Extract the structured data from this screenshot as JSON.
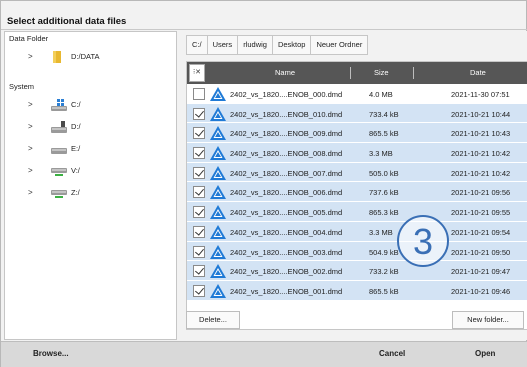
{
  "dialog": {
    "title": "Select additional data files"
  },
  "left_panel": {
    "data_folder_label": "Data Folder",
    "data_folders": [
      {
        "label": "D:/DATA",
        "icon": "folder-icon"
      }
    ],
    "system_label": "System",
    "drives": [
      {
        "label": "C:/",
        "icon": "system-drive-icon"
      },
      {
        "label": "D:/",
        "icon": "hard-drive-icon"
      },
      {
        "label": "E:/",
        "icon": "hard-drive-icon"
      },
      {
        "label": "V:/",
        "icon": "network-drive-icon"
      },
      {
        "label": "Z:/",
        "icon": "network-drive-icon"
      }
    ]
  },
  "breadcrumbs": [
    "C:/",
    "Users",
    "rludwig",
    "Desktop",
    "Neuer Ordner"
  ],
  "table": {
    "column_toggle": "⁝✕",
    "columns": {
      "name": "Name",
      "size": "Size",
      "date": "Date"
    },
    "rows": [
      {
        "name": "2402_vs_1820....ENOB_000.dmd",
        "size": "4.0 MB",
        "date": "2021-11-30 07:51",
        "checked": false
      },
      {
        "name": "2402_vs_1820....ENOB_010.dmd",
        "size": "733.4 kB",
        "date": "2021-10-21 10:44",
        "checked": true
      },
      {
        "name": "2402_vs_1820....ENOB_009.dmd",
        "size": "865.5 kB",
        "date": "2021-10-21 10:43",
        "checked": true
      },
      {
        "name": "2402_vs_1820....ENOB_008.dmd",
        "size": "3.3 MB",
        "date": "2021-10-21 10:42",
        "checked": true
      },
      {
        "name": "2402_vs_1820....ENOB_007.dmd",
        "size": "505.0 kB",
        "date": "2021-10-21 10:42",
        "checked": true
      },
      {
        "name": "2402_vs_1820....ENOB_006.dmd",
        "size": "737.6 kB",
        "date": "2021-10-21 09:56",
        "checked": true
      },
      {
        "name": "2402_vs_1820....ENOB_005.dmd",
        "size": "865.3 kB",
        "date": "2021-10-21 09:55",
        "checked": true
      },
      {
        "name": "2402_vs_1820....ENOB_004.dmd",
        "size": "3.3 MB",
        "date": "2021-10-21 09:54",
        "checked": true
      },
      {
        "name": "2402_vs_1820....ENOB_003.dmd",
        "size": "504.9 kB",
        "date": "2021-10-21 09:50",
        "checked": true
      },
      {
        "name": "2402_vs_1820....ENOB_002.dmd",
        "size": "733.2 kB",
        "date": "2021-10-21 09:47",
        "checked": true
      },
      {
        "name": "2402_vs_1820....ENOB_001.dmd",
        "size": "865.5 kB",
        "date": "2021-10-21 09:46",
        "checked": true
      }
    ]
  },
  "buttons": {
    "delete": "Delete...",
    "new_folder": "New folder..."
  },
  "bottom_bar": {
    "browse": "Browse...",
    "cancel": "Cancel",
    "open": "Open"
  },
  "annotation": {
    "step_number": "3"
  },
  "colors": {
    "selected_row": "#d3e3f4",
    "header": "#565656",
    "annotation": "#3a6fb5",
    "file_icon": "#1f7ad6"
  }
}
